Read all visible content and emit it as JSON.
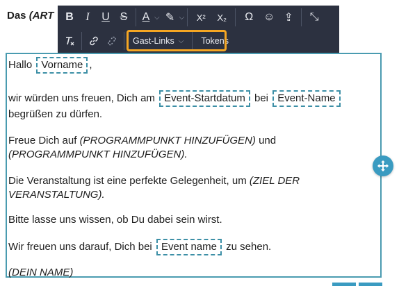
{
  "heading": {
    "bold": "Das",
    "italic": "(ART"
  },
  "toolbar": {
    "row1": [
      "B",
      "I",
      "U",
      "S",
      "A",
      "✎",
      "X²",
      "X₂",
      "Ω",
      "☺",
      "⇪",
      "⤡"
    ],
    "guest_links_label": "Gast-Links",
    "tokens_label": "Tokens",
    "highlight_color": "#f5a623"
  },
  "editor": {
    "line1_prefix": "Hallo",
    "token_firstname": "Vorname",
    "line1_suffix": ",",
    "line2_prefix": "wir würden uns freuen, Dich am",
    "token_event_start": "Event-Startdatum",
    "line2_mid": "bei",
    "token_event_name": "Event-Name",
    "line2b": "begrüßen zu dürfen.",
    "line3_prefix": "Freue Dich auf",
    "line3_italic1": "(PROGRAMMPUNKT HINZUFÜGEN)",
    "line3_mid": "und",
    "line3_italic2": "(PROGRAMMPUNKT HINZUFÜGEN).",
    "line4_prefix": "Die Veranstaltung ist eine perfekte Gelegenheit, um",
    "line4_italic1": "(ZIEL DER",
    "line4_italic2": "VERANSTALTUNG).",
    "line5": "Bitte lasse uns wissen, ob Du dabei sein wirst.",
    "line6_prefix": "Wir freuen uns darauf, Dich bei",
    "token_event_name_lower": "Event name",
    "line6_suffix": "zu sehen.",
    "line7_italic": "(DEIN NAME)"
  }
}
